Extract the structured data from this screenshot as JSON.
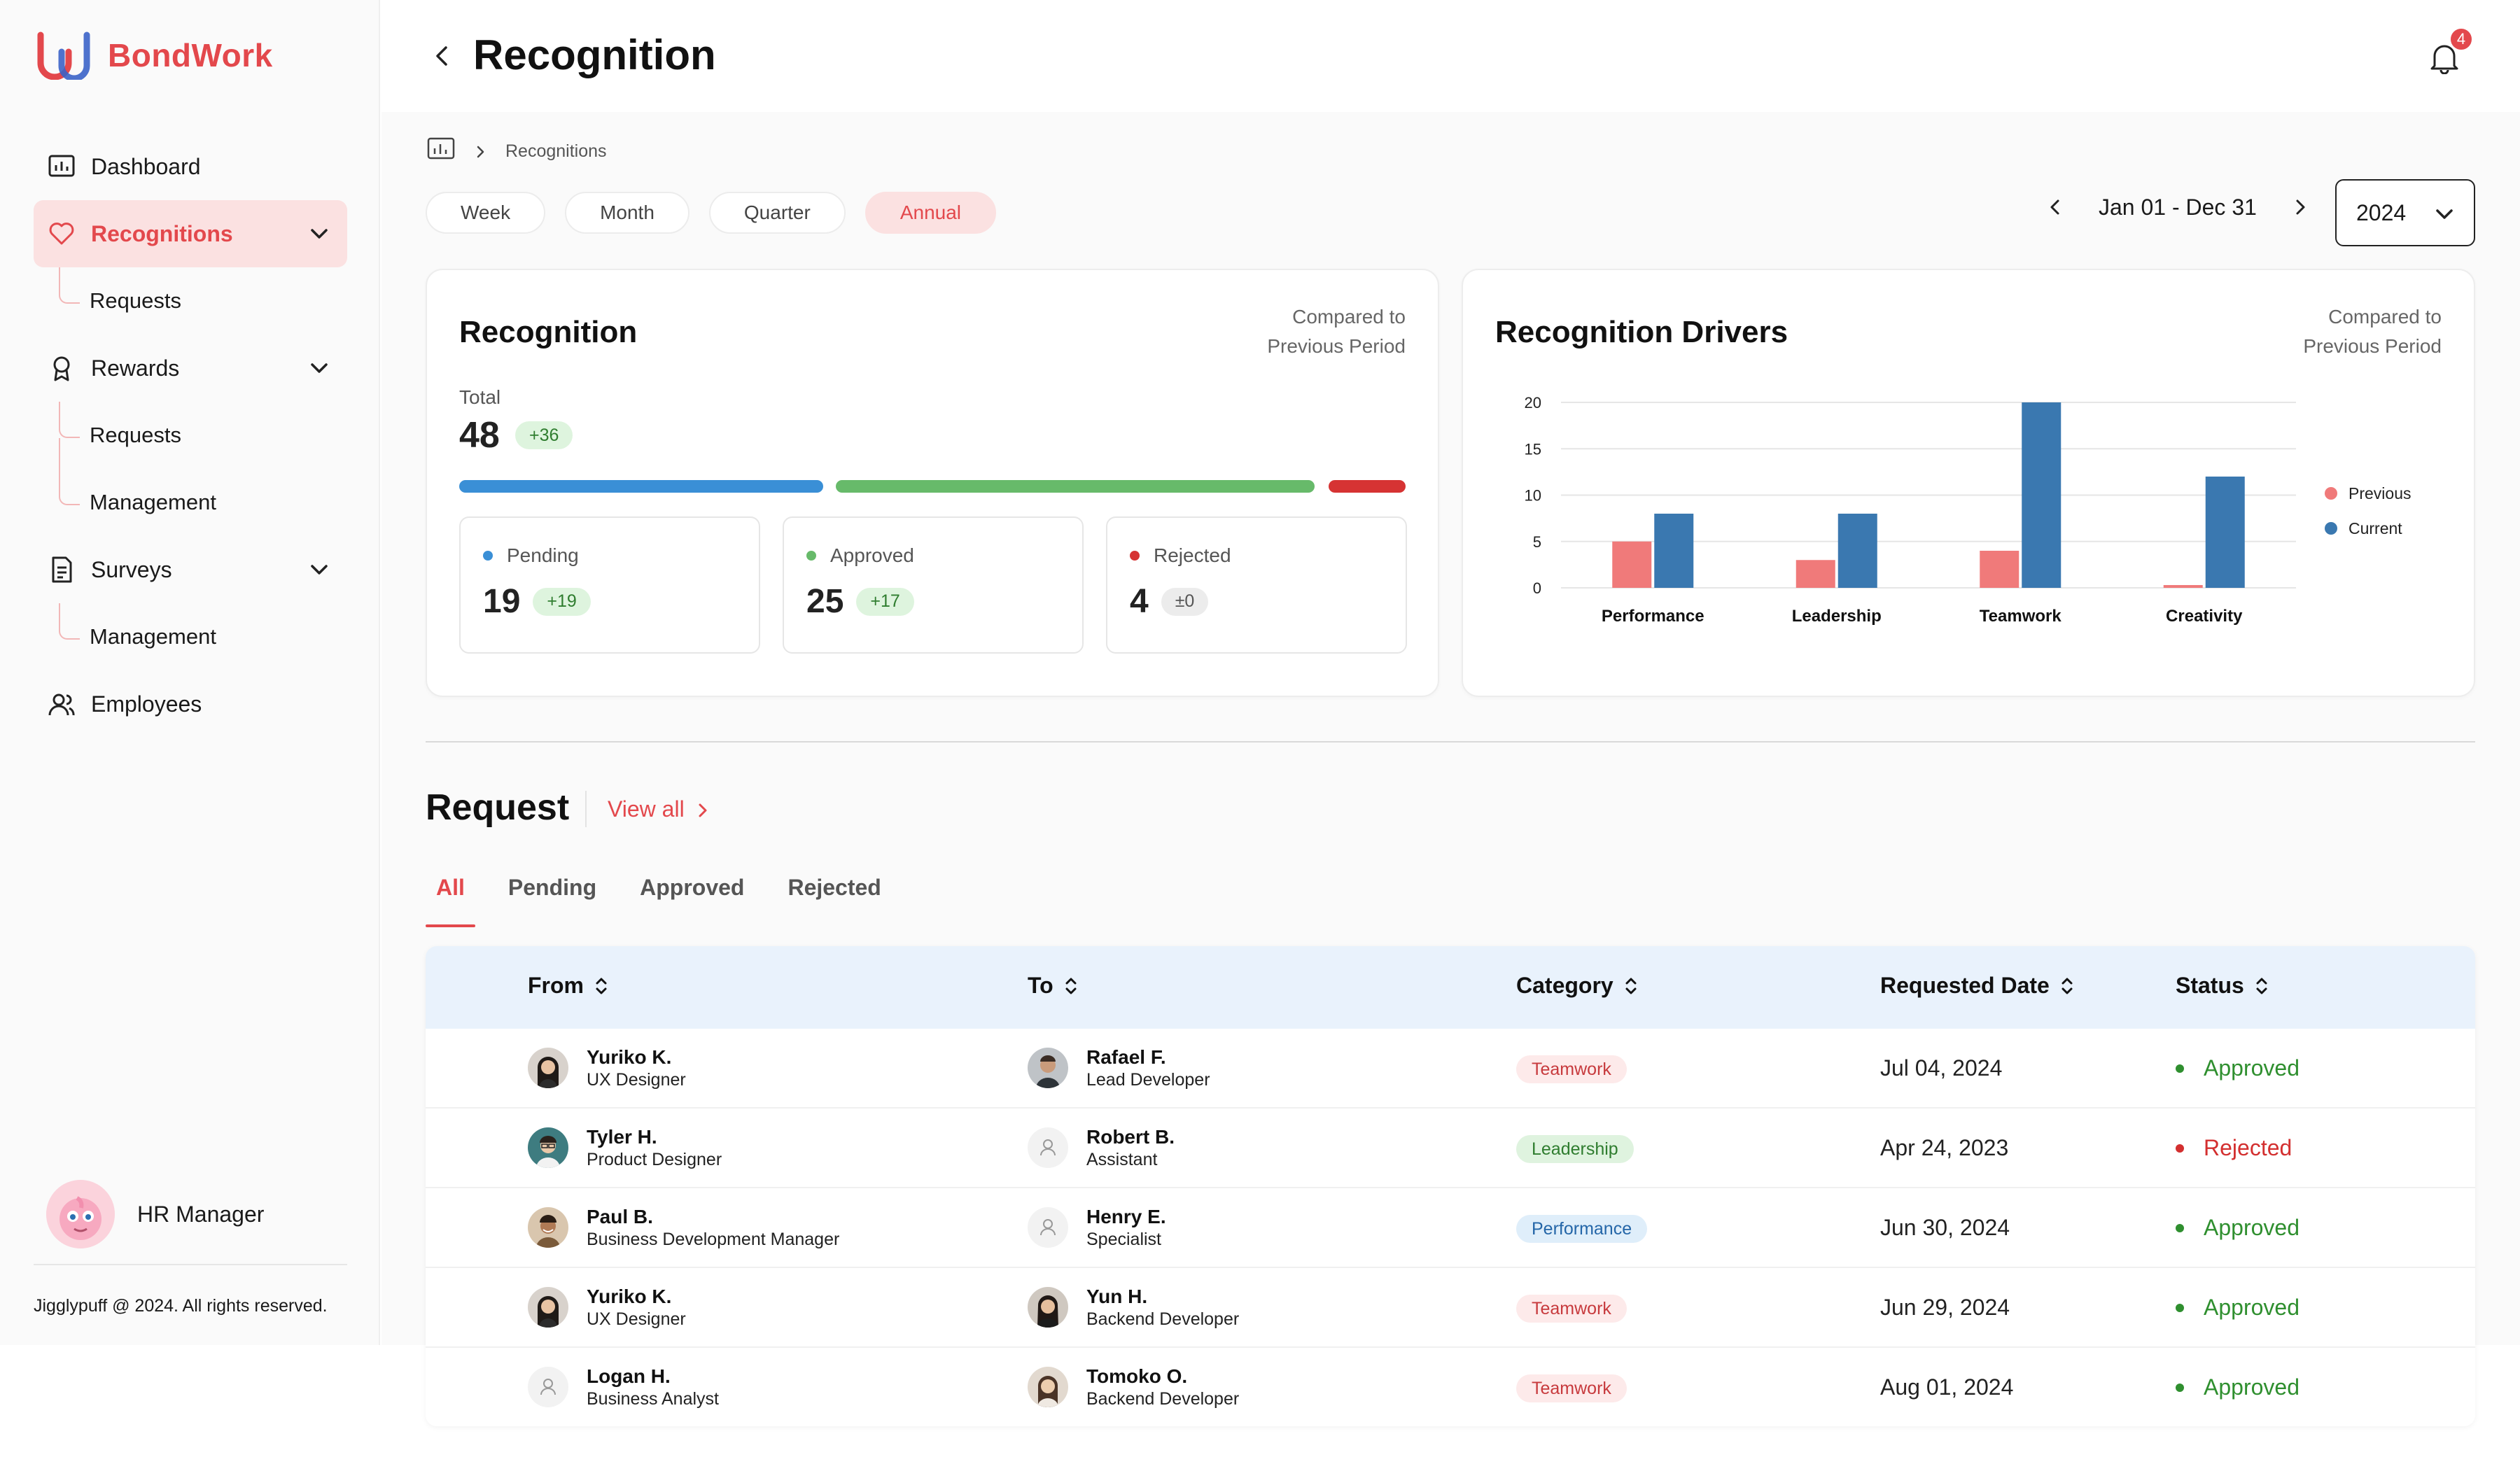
{
  "brand": {
    "name": "BondWork",
    "accent": "#e3484c"
  },
  "nav": {
    "dashboard": "Dashboard",
    "recognitions": "Recognitions",
    "recognitions_requests": "Requests",
    "rewards": "Rewards",
    "rewards_requests": "Requests",
    "rewards_management": "Management",
    "surveys": "Surveys",
    "surveys_management": "Management",
    "employees": "Employees"
  },
  "user": {
    "role": "HR Manager"
  },
  "footer": {
    "copyright": "Jigglypuff @ 2024. All rights reserved."
  },
  "header": {
    "title": "Recognition",
    "notification_count": "4"
  },
  "breadcrumb": {
    "current": "Recognitions"
  },
  "periods": {
    "week": "Week",
    "month": "Month",
    "quarter": "Quarter",
    "annual": "Annual",
    "selected": "Annual"
  },
  "date_range": {
    "label": "Jan 01 - Dec 31",
    "year": "2024"
  },
  "recognition_card": {
    "title": "Recognition",
    "compare_line1": "Compared to",
    "compare_line2": "Previous Period",
    "total_label": "Total",
    "total_value": "48",
    "total_delta": "+36",
    "pending_label": "Pending",
    "pending_value": "19",
    "pending_delta": "+19",
    "approved_label": "Approved",
    "approved_value": "25",
    "approved_delta": "+17",
    "rejected_label": "Rejected",
    "rejected_value": "4",
    "rejected_delta": "±0",
    "colors": {
      "pending": "#3a8fd6",
      "approved": "#67ba6a",
      "rejected": "#d63333"
    }
  },
  "drivers_card": {
    "title": "Recognition Drivers",
    "compare_line1": "Compared to",
    "compare_line2": "Previous Period"
  },
  "chart_data": {
    "type": "bar",
    "categories": [
      "Performance",
      "Leadership",
      "Teamwork",
      "Creativity"
    ],
    "series": [
      {
        "name": "Previous",
        "values": [
          5,
          3,
          4,
          0.3
        ],
        "color": "#f07a7a"
      },
      {
        "name": "Current",
        "values": [
          8,
          8,
          20,
          12
        ],
        "color": "#3a78b0"
      }
    ],
    "ylim": [
      0,
      20
    ],
    "yticks": [
      0,
      5,
      10,
      15,
      20
    ],
    "legend": "right",
    "grid": true
  },
  "requests": {
    "title": "Request",
    "view_all": "View all",
    "tabs": [
      "All",
      "Pending",
      "Approved",
      "Rejected"
    ],
    "active_tab": "All",
    "columns": {
      "from": "From",
      "to": "To",
      "category": "Category",
      "date": "Requested Date",
      "status": "Status"
    },
    "rows": [
      {
        "from_name": "Yuriko K.",
        "from_role": "UX Designer",
        "to_name": "Rafael F.",
        "to_role": "Lead Developer",
        "category": "Teamwork",
        "date": "Jul 04, 2024",
        "status": "Approved"
      },
      {
        "from_name": "Tyler H.",
        "from_role": "Product Designer",
        "to_name": "Robert B.",
        "to_role": "Assistant",
        "category": "Leadership",
        "date": "Apr 24, 2023",
        "status": "Rejected"
      },
      {
        "from_name": "Paul B.",
        "from_role": "Business Development Manager",
        "to_name": "Henry E.",
        "to_role": "Specialist",
        "category": "Performance",
        "date": "Jun 30, 2024",
        "status": "Approved"
      },
      {
        "from_name": "Yuriko K.",
        "from_role": "UX Designer",
        "to_name": "Yun H.",
        "to_role": "Backend Developer",
        "category": "Teamwork",
        "date": "Jun 29, 2024",
        "status": "Approved"
      },
      {
        "from_name": "Logan H.",
        "from_role": "Business Analyst",
        "to_name": "Tomoko O.",
        "to_role": "Backend Developer",
        "category": "Teamwork",
        "date": "Aug 01, 2024",
        "status": "Approved"
      }
    ]
  }
}
